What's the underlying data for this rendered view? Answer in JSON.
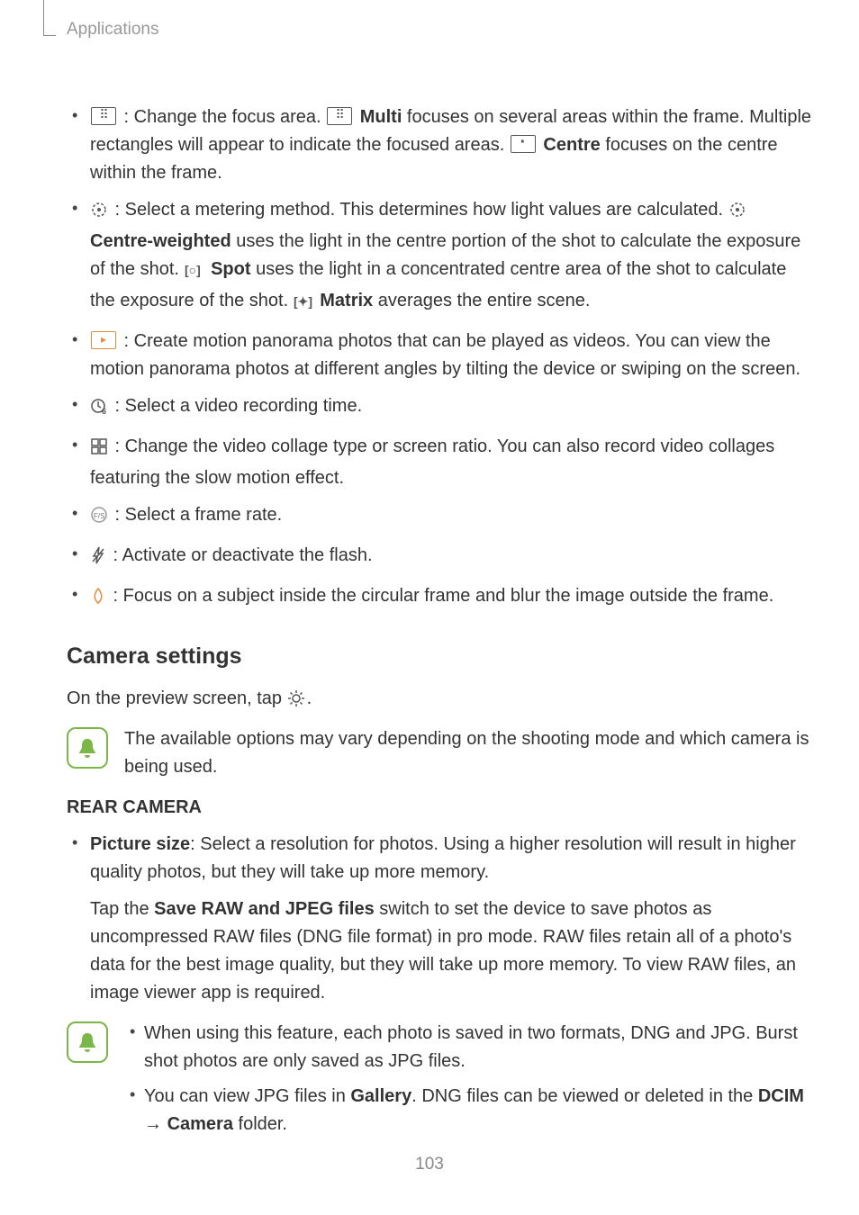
{
  "header": {
    "section_label": "Applications"
  },
  "page_number": "103",
  "main_list": {
    "items": [
      {
        "focus_pre": " : Change the focus area. ",
        "focus_multi": "Multi",
        "focus_multi_after": " focuses on several areas within the frame. Multiple rectangles will appear to indicate the focused areas. ",
        "focus_centre": "Centre",
        "focus_centre_after": " focuses on the centre within the frame."
      },
      {
        "meter_pre": " : Select a metering method. This determines how light values are calculated. ",
        "meter_cw": "Centre-weighted",
        "meter_cw_after": " uses the light in the centre portion of the shot to calculate the exposure of the shot. ",
        "meter_spot": "Spot",
        "meter_spot_after": " uses the light in a concentrated centre area of the shot to calculate the exposure of the shot. ",
        "meter_matrix": "Matrix",
        "meter_matrix_after": " averages the entire scene."
      },
      {
        "motion": " : Create motion panorama photos that can be played as videos. You can view the motion panorama photos at different angles by tilting the device or swiping on the screen."
      },
      {
        "rectime": " : Select a video recording time."
      },
      {
        "collage": " : Change the video collage type or screen ratio. You can also record video collages featuring the slow motion effect."
      },
      {
        "framerate": " : Select a frame rate."
      },
      {
        "flash": " : Activate or deactivate the flash."
      },
      {
        "blur": " : Focus on a subject inside the circular frame and blur the image outside the frame."
      }
    ]
  },
  "section": {
    "heading": "Camera settings",
    "intro_pre": "On the preview screen, tap ",
    "intro_post": ".",
    "note1": "The available options may vary depending on the shooting mode and which camera is being used.",
    "rear_heading": "REAR CAMERA",
    "picsize_label": "Picture size",
    "picsize_text": ": Select a resolution for photos. Using a higher resolution will result in higher quality photos, but they will take up more memory.",
    "raw_pre": "Tap the ",
    "raw_label": "Save RAW and JPEG files",
    "raw_post": " switch to set the device to save photos as uncompressed RAW files (DNG file format) in pro mode. RAW files retain all of a photo's data for the best image quality, but they will take up more memory. To view RAW files, an image viewer app is required.",
    "note2": {
      "a": "When using this feature, each photo is saved in two formats, DNG and JPG. Burst shot photos are only saved as JPG files.",
      "b_pre": "You can view JPG files in ",
      "b_gallery": "Gallery",
      "b_mid": ". DNG files can be viewed or deleted in the ",
      "b_dcim": "DCIM",
      "b_arrow": " → ",
      "b_camera": "Camera",
      "b_post": " folder."
    }
  }
}
